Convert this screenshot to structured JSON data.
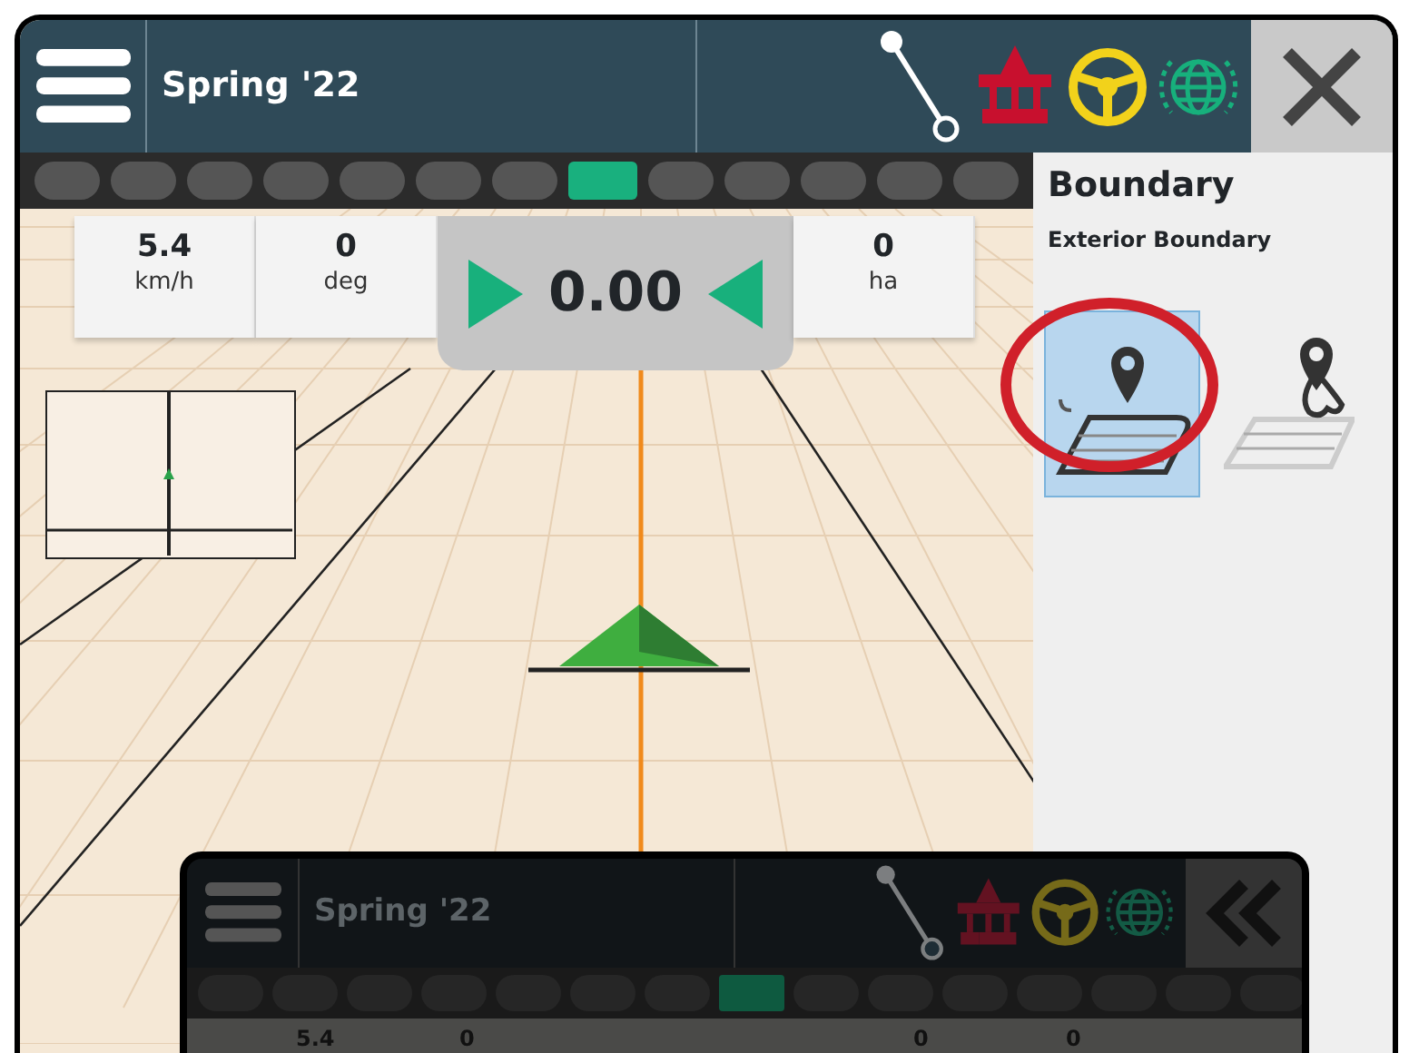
{
  "header": {
    "title": "Spring '22"
  },
  "lightbar": [
    {
      "on": false
    },
    {
      "on": false
    },
    {
      "on": false
    },
    {
      "on": false
    },
    {
      "on": false
    },
    {
      "on": false
    },
    {
      "on": false
    },
    {
      "on": true
    },
    {
      "on": false
    },
    {
      "on": false
    },
    {
      "on": false
    },
    {
      "on": false
    },
    {
      "on": false
    }
  ],
  "stats_left": [
    {
      "value": "5.4",
      "unit": "km/h"
    },
    {
      "value": "0",
      "unit": "deg"
    }
  ],
  "cross_track": {
    "value": "0.00"
  },
  "stats_right": [
    {
      "value": "0",
      "unit": "ha"
    }
  ],
  "panel": {
    "title": "Boundary",
    "subtitle": "Exterior Boundary",
    "options": [
      {
        "kind": "area",
        "selected": true
      },
      {
        "kind": "line",
        "selected": false
      }
    ]
  },
  "inset": {
    "title": "Spring '22",
    "lightbar": [
      {
        "on": false
      },
      {
        "on": false
      },
      {
        "on": false
      },
      {
        "on": false
      },
      {
        "on": false
      },
      {
        "on": false
      },
      {
        "on": false
      },
      {
        "on": true
      },
      {
        "on": false
      },
      {
        "on": false
      },
      {
        "on": false
      },
      {
        "on": false
      },
      {
        "on": false
      },
      {
        "on": false
      },
      {
        "on": false
      }
    ],
    "stats": [
      "5.4",
      "0",
      "0",
      "0"
    ]
  }
}
